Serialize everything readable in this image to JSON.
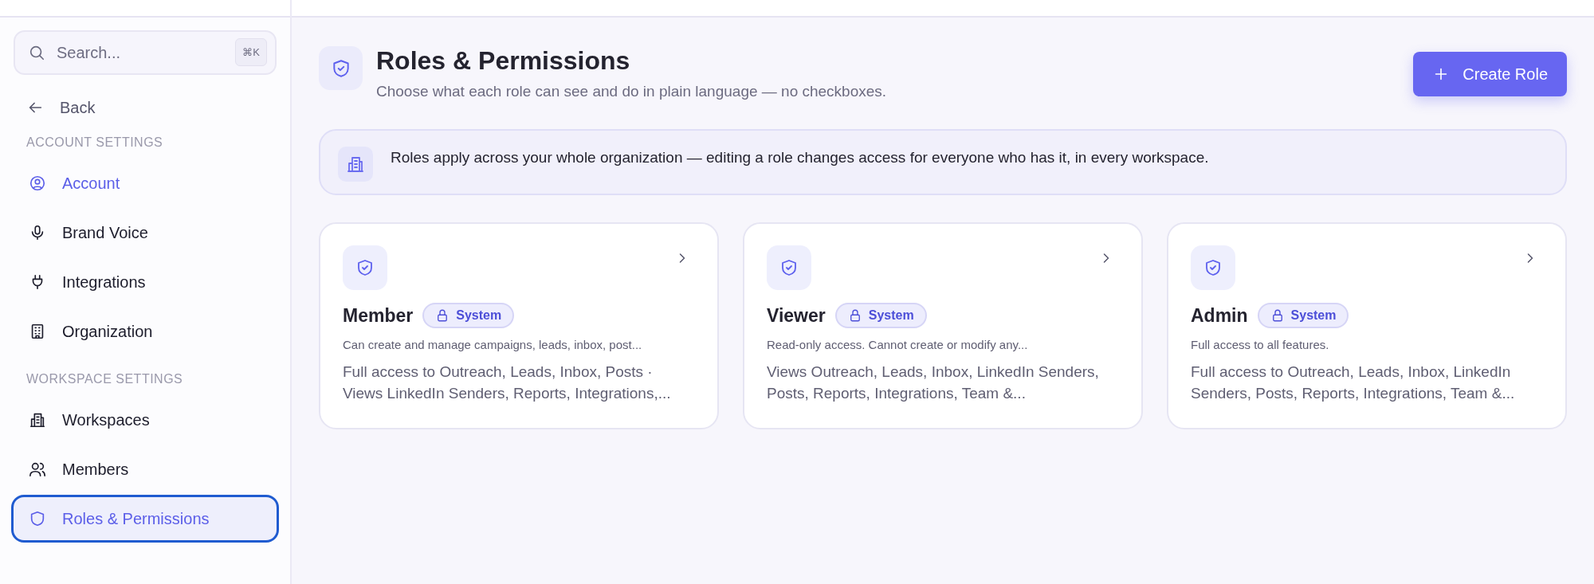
{
  "sidebar": {
    "search": {
      "placeholder": "Search...",
      "shortcut": "⌘K"
    },
    "back": "Back",
    "sections": [
      {
        "heading": "ACCOUNT SETTINGS",
        "items": [
          {
            "label": "Account",
            "kind": "user",
            "selected": false,
            "accent": true
          },
          {
            "label": "Brand Voice",
            "kind": "mic",
            "selected": false,
            "accent": false
          },
          {
            "label": "Integrations",
            "kind": "plug",
            "selected": false,
            "accent": false
          },
          {
            "label": "Organization",
            "kind": "building",
            "selected": false,
            "accent": false
          }
        ]
      },
      {
        "heading": "WORKSPACE SETTINGS",
        "items": [
          {
            "label": "Workspaces",
            "kind": "office",
            "selected": false,
            "accent": false
          },
          {
            "label": "Members",
            "kind": "users",
            "selected": false,
            "accent": false
          },
          {
            "label": "Roles & Permissions",
            "kind": "shield",
            "selected": true,
            "accent": true
          }
        ]
      }
    ]
  },
  "header": {
    "title": "Roles & Permissions",
    "subtitle": "Choose what each role can see and do in plain language — no checkboxes.",
    "button": "Create Role"
  },
  "banner": "Roles apply across your whole organization — editing a role changes access for everyone who has it, in every workspace.",
  "roles": [
    {
      "name": "Member",
      "badge": "System",
      "description": "Can create and manage campaigns, leads, inbox, post...",
      "summary": "Full access to Outreach, Leads, Inbox, Posts · Views LinkedIn Senders, Reports, Integrations,..."
    },
    {
      "name": "Viewer",
      "badge": "System",
      "description": "Read-only access. Cannot create or modify any...",
      "summary": "Views Outreach, Leads, Inbox, LinkedIn Senders, Posts, Reports, Integrations, Team &..."
    },
    {
      "name": "Admin",
      "badge": "System",
      "description": "Full access to all features.",
      "summary": "Full access to Outreach, Leads, Inbox, LinkedIn Senders, Posts, Reports, Integrations, Team &..."
    }
  ]
}
